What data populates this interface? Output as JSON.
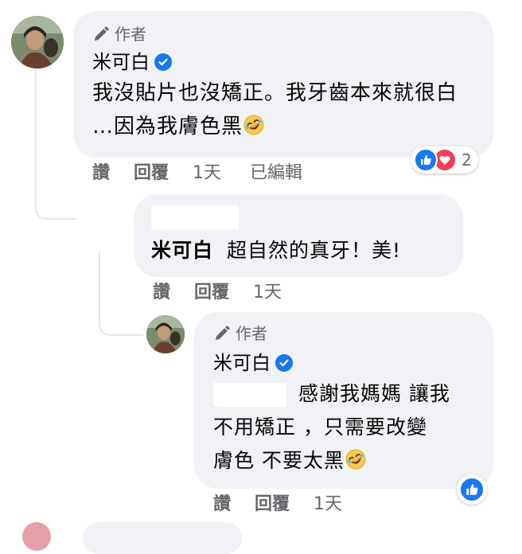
{
  "comments": [
    {
      "author_tag": "作者",
      "name": "米可白",
      "text": "我沒貼片也沒矯正。我牙齒本來就很白 …因為我膚色黑",
      "emoji": "rolling-on-floor-laughing",
      "actions": {
        "like": "讚",
        "reply": "回覆",
        "time": "1天",
        "edited": "已編輯"
      },
      "reactions": {
        "icons": [
          "like-reaction-icon",
          "love-reaction-icon"
        ],
        "count": "2"
      }
    },
    {
      "mention": "米可白",
      "text": "超自然的真牙！美!",
      "actions": {
        "like": "讚",
        "reply": "回覆",
        "time": "1天"
      }
    },
    {
      "author_tag": "作者",
      "name": "米可白",
      "text_line1": "感謝我媽媽 讓我",
      "text_line2": "不用矯正 ，只需要改變",
      "text_line3": "膚色 不要太黑",
      "emoji": "rolling-on-floor-laughing",
      "actions": {
        "like": "讚",
        "reply": "回覆",
        "time": "1天"
      },
      "reactions": {
        "icons": [
          "like-reaction-icon"
        ]
      }
    }
  ],
  "colors": {
    "bubble": "#f0f2f5",
    "secondary_text": "#65676b",
    "verified_blue": "#1877f2",
    "love_red": "#f33e58"
  }
}
